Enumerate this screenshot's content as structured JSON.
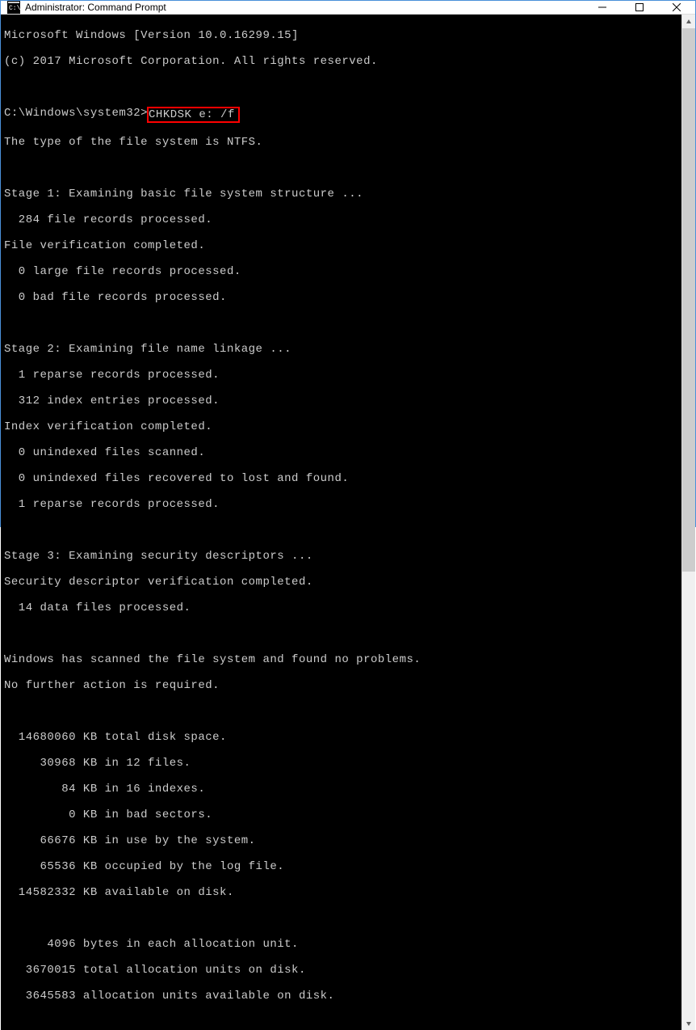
{
  "window": {
    "title": "Administrator: Command Prompt"
  },
  "terminal": {
    "header_line1": "Microsoft Windows [Version 10.0.16299.15]",
    "header_line2": "(c) 2017 Microsoft Corporation. All rights reserved.",
    "prompt": "C:\\Windows\\system32>",
    "command": "CHKDSK e: /f",
    "output": {
      "fs_type": "The type of the file system is NTFS.",
      "stage1_header": "Stage 1: Examining basic file system structure ...",
      "stage1_l1": "  284 file records processed.",
      "stage1_l2": "File verification completed.",
      "stage1_l3": "  0 large file records processed.",
      "stage1_l4": "  0 bad file records processed.",
      "stage2_header": "Stage 2: Examining file name linkage ...",
      "stage2_l1": "  1 reparse records processed.",
      "stage2_l2": "  312 index entries processed.",
      "stage2_l3": "Index verification completed.",
      "stage2_l4": "  0 unindexed files scanned.",
      "stage2_l5": "  0 unindexed files recovered to lost and found.",
      "stage2_l6": "  1 reparse records processed.",
      "stage3_header": "Stage 3: Examining security descriptors ...",
      "stage3_l1": "Security descriptor verification completed.",
      "stage3_l2": "  14 data files processed.",
      "result_l1": "Windows has scanned the file system and found no problems.",
      "result_l2": "No further action is required.",
      "stats_l1": "  14680060 KB total disk space.",
      "stats_l2": "     30968 KB in 12 files.",
      "stats_l3": "        84 KB in 16 indexes.",
      "stats_l4": "         0 KB in bad sectors.",
      "stats_l5": "     66676 KB in use by the system.",
      "stats_l6": "     65536 KB occupied by the log file.",
      "stats_l7": "  14582332 KB available on disk.",
      "stats_l8": "      4096 bytes in each allocation unit.",
      "stats_l9": "   3670015 total allocation units on disk.",
      "stats_l10": "   3645583 allocation units available on disk."
    }
  }
}
